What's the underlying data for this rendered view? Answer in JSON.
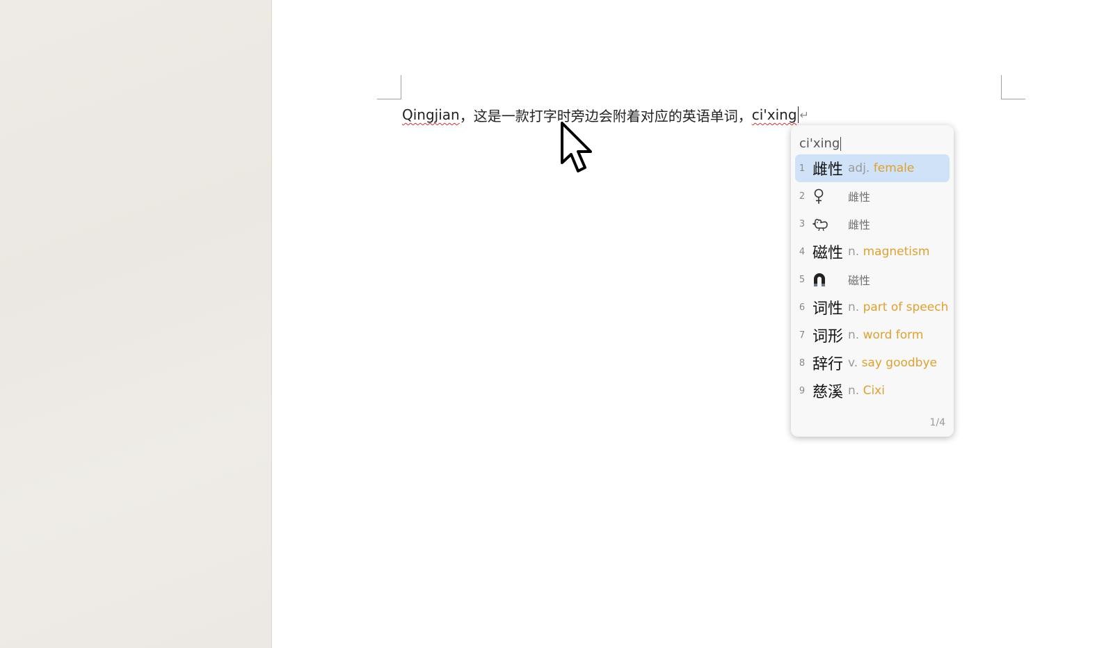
{
  "document": {
    "text_pinyin_word": "Qingjian",
    "text_body": "，这是一款打字时旁边会附着对应的英语单词，",
    "composing": "ci'xing",
    "para_mark": "↵"
  },
  "ime": {
    "input": "ci'xing",
    "page_indicator": "1/4",
    "candidates": [
      {
        "num": "1",
        "word": "雌性",
        "pos": "adj.",
        "gloss": "female",
        "selected": true
      },
      {
        "num": "2",
        "icon": "female-symbol-icon",
        "zh": "雌性"
      },
      {
        "num": "3",
        "icon": "hen-icon",
        "zh": "雌性"
      },
      {
        "num": "4",
        "word": "磁性",
        "pos": "n.",
        "gloss": "magnetism"
      },
      {
        "num": "5",
        "icon": "magnet-icon",
        "zh": "磁性"
      },
      {
        "num": "6",
        "word": "词性",
        "pos": "n.",
        "gloss": "part of speech"
      },
      {
        "num": "7",
        "word": "词形",
        "pos": "n.",
        "gloss": "word form"
      },
      {
        "num": "8",
        "word": "辞行",
        "pos": "v.",
        "gloss": "say goodbye"
      },
      {
        "num": "9",
        "word": "慈溪",
        "pos": "n.",
        "gloss": "Cixi"
      }
    ]
  },
  "colors": {
    "selected_bg": "#cfe2f7",
    "gloss": "#e0a030",
    "squiggle": "#d0303a"
  }
}
